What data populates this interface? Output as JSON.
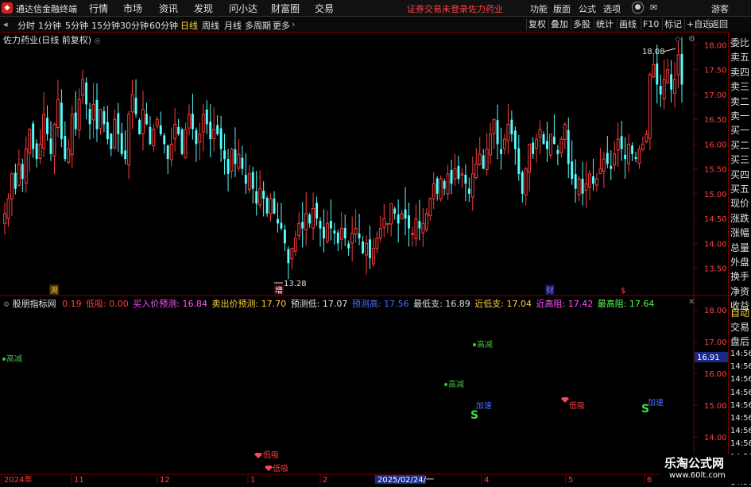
{
  "app": {
    "title": "通达信金融终端"
  },
  "menu": [
    "行情",
    "市场",
    "资讯",
    "发现",
    "问小达",
    "财富圈",
    "交易"
  ],
  "login_notice": "证券交易未登录",
  "stock_name_top": "佐力药业",
  "menu_right": [
    "功能",
    "版面",
    "公式",
    "选项",
    "游客"
  ],
  "toolbar": {
    "periods": [
      "分时",
      "1分钟",
      "5分钟",
      "15分钟",
      "30分钟",
      "60分钟",
      "日线",
      "周线",
      "月线",
      "多周期",
      "更多"
    ],
    "active": "日线",
    "right": [
      "复权",
      "叠加",
      "多股",
      "统计",
      "画线",
      "F10",
      "标记",
      "+自选",
      "返回"
    ]
  },
  "main_chart": {
    "title": "佐力药业(日线 前复权)",
    "high_label": "18.08",
    "low_label": "13.28",
    "markers": [
      {
        "text": "溯",
        "color": "#ffcc33"
      },
      {
        "text": "增",
        "color": "#ffffff"
      },
      {
        "text": "财",
        "color": "#8888ff"
      },
      {
        "text": "$",
        "color": "#ff4040"
      }
    ]
  },
  "chart_data": {
    "type": "candlestick",
    "y_ticks": [
      "18.00",
      "17.50",
      "17.00",
      "16.50",
      "16.00",
      "15.50",
      "15.00",
      "14.50",
      "14.00",
      "13.50"
    ],
    "ylim": [
      13.3,
      18.2
    ],
    "x_ticks": [
      "2024年",
      "11",
      "12",
      "1",
      "2",
      "2025/02/24/一",
      "4",
      "5",
      "6"
    ],
    "close": [
      14.6,
      14.9,
      15.4,
      15.1,
      15.6,
      15.3,
      15.9,
      16.3,
      15.9,
      15.7,
      16.0,
      16.6,
      16.2,
      15.8,
      16.4,
      16.9,
      16.1,
      15.7,
      15.9,
      16.6,
      16.3,
      16.9,
      17.3,
      16.8,
      16.4,
      16.8,
      16.3,
      16.7,
      16.4,
      16.1,
      15.9,
      16.5,
      16.2,
      15.8,
      15.7,
      16.6,
      17.0,
      16.6,
      16.2,
      16.7,
      16.4,
      16.0,
      16.3,
      16.5,
      16.2,
      16.0,
      15.7,
      16.0,
      16.4,
      16.2,
      15.8,
      16.3,
      16.6,
      16.3,
      16.0,
      16.2,
      16.6,
      16.4,
      16.1,
      16.3,
      16.2,
      15.9,
      15.7,
      15.4,
      15.9,
      15.6,
      15.8,
      15.5,
      15.2,
      15.4,
      15.1,
      14.8,
      15.1,
      14.9,
      14.6,
      14.9,
      14.6,
      14.4,
      14.3,
      14.0,
      13.6,
      13.9,
      14.1,
      14.4,
      14.3,
      14.6,
      14.4,
      14.7,
      14.5,
      14.3,
      14.1,
      14.4,
      14.3,
      14.2,
      14.0,
      14.3,
      14.1,
      13.9,
      14.2,
      14.3,
      14.1,
      13.8,
      14.0,
      13.7,
      13.9,
      14.1,
      14.3,
      14.5,
      14.4,
      14.8,
      14.6,
      14.4,
      14.6,
      14.5,
      14.3,
      14.2,
      14.5,
      14.3,
      14.4,
      14.6,
      14.9,
      15.2,
      15.0,
      15.3,
      15.1,
      15.4,
      15.2,
      15.5,
      15.3,
      15.4,
      15.2,
      15.0,
      15.4,
      15.6,
      15.8,
      15.5,
      15.9,
      16.2,
      16.5,
      16.0,
      15.8,
      16.1,
      16.4,
      16.2,
      15.9,
      15.4,
      15.0,
      15.5,
      16.0,
      15.8,
      16.1,
      16.3,
      16.0,
      15.9,
      16.2,
      16.0,
      15.8,
      16.1,
      16.4,
      15.6,
      15.3,
      15.1,
      15.3,
      15.0,
      15.2,
      15.4,
      15.2,
      15.3,
      15.5,
      15.7,
      15.6,
      15.5,
      15.8,
      16.1,
      15.9,
      15.7,
      16.0,
      15.8,
      15.7,
      15.9,
      16.0,
      16.2,
      17.4,
      17.6,
      17.2,
      17.0,
      17.3,
      17.5,
      17.1,
      17.3,
      17.8,
      17.2
    ],
    "high_point": 18.08,
    "low_point": 13.28
  },
  "indicator": {
    "name": "股朋指标网",
    "values": [
      {
        "label": "0.19",
        "color": "#ff4040"
      },
      {
        "label": "低吸: 0.00",
        "color": "#ff4040"
      },
      {
        "label": "买入价预测: 16.84",
        "color": "#ff55ff"
      },
      {
        "label": "卖出价预测: 17.70",
        "color": "#ffd23c"
      },
      {
        "label": "预测低: 17.07",
        "color": "#e0e0e0"
      },
      {
        "label": "预测高: 17.56",
        "color": "#4a6cff"
      },
      {
        "label": "最低支: 16.89",
        "color": "#e0e0e0"
      },
      {
        "label": "近低支: 17.04",
        "color": "#ffd23c"
      },
      {
        "label": "近高阻: 17.42",
        "color": "#ff55ff"
      },
      {
        "label": "最高阻: 17.64",
        "color": "#55ff55"
      }
    ],
    "y_ticks": [
      "18.00",
      "17.00",
      "16.00",
      "15.00",
      "14.00"
    ],
    "current_price": "16.91",
    "signals": [
      {
        "text": "高减",
        "color": "#40c040"
      },
      {
        "text": "高减",
        "color": "#40c040"
      },
      {
        "text": "高减",
        "color": "#40c040"
      },
      {
        "text": "加速",
        "color": "#4a6cff"
      },
      {
        "text": "加速",
        "color": "#4a6cff"
      },
      {
        "text": "低吸",
        "color": "#ff4040"
      },
      {
        "text": "低吸",
        "color": "#ff4040"
      },
      {
        "text": "低吸",
        "color": "#ff4040"
      }
    ],
    "s_marker": "S"
  },
  "side": {
    "top": [
      "委比",
      "卖五",
      "卖四",
      "卖三",
      "卖二",
      "卖一",
      "买一",
      "买二",
      "买三",
      "买四",
      "买五",
      "现价",
      "涨跌",
      "涨幅",
      "总量",
      "外盘",
      "换手",
      "净资",
      "收益"
    ],
    "bottom": [
      "自动",
      "交易",
      "盘后"
    ],
    "bottom_times": [
      "14:56",
      "14:56",
      "14:56",
      "14:56",
      "14:56",
      "14:56",
      "14:56",
      "14:56",
      "14:56",
      "14:56",
      "14:56"
    ]
  },
  "watermark": {
    "title": "乐淘公式网",
    "url": "www.60lt.com"
  }
}
